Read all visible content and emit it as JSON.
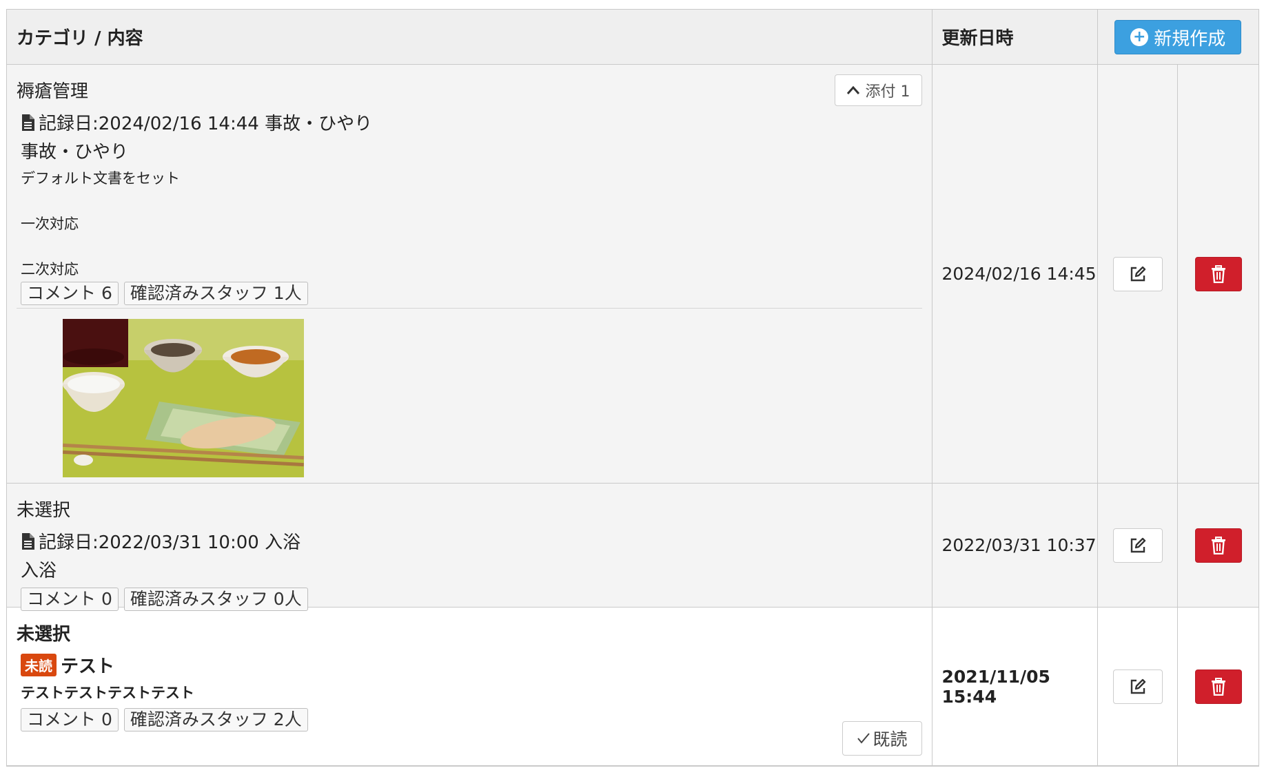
{
  "header": {
    "content_col": "カテゴリ / 内容",
    "date_col": "更新日時",
    "new_button": "新規作成"
  },
  "rows": [
    {
      "category": "褥瘡管理",
      "record": "記録日:2024/02/16 14:44 事故・ひやり",
      "subtitle": "事故・ひやり",
      "body_lines": [
        "デフォルト文書をセット",
        "一次対応",
        "二次対応"
      ],
      "comments": "コメント 6",
      "staff": "確認済みスタッフ 1人",
      "attach_label": "添付 1",
      "updated": "2024/02/16 14:45"
    },
    {
      "category": "未選択",
      "record": "記録日:2022/03/31 10:00 入浴",
      "subtitle": "入浴",
      "comments": "コメント 0",
      "staff": "確認済みスタッフ 0人",
      "updated": "2022/03/31 10:37"
    },
    {
      "category": "未選択",
      "unread_badge": "未読",
      "title": "テスト",
      "body": "テストテストテストテスト",
      "comments": "コメント 0",
      "staff": "確認済みスタッフ 2人",
      "read_button": "既読",
      "updated": "2021/11/05 15:44"
    }
  ],
  "icons": {
    "document": "document-icon",
    "edit": "edit-icon",
    "trash": "trash-icon",
    "plus": "plus-circle-icon",
    "chevron_up": "chevron-up-icon",
    "check": "check-icon"
  },
  "colors": {
    "primary": "#3ca0e0",
    "danger": "#d01f2b",
    "unread": "#d9480f"
  }
}
